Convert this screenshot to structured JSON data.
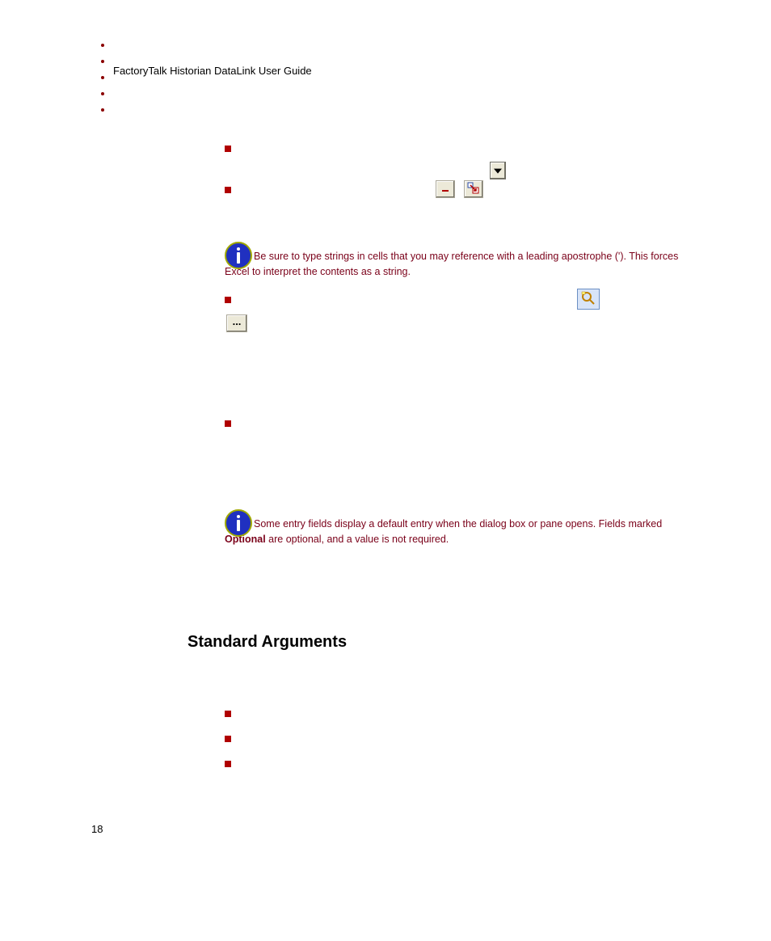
{
  "doc": {
    "title": "FactoryTalk Historian DataLink User Guide",
    "page_number": "18"
  },
  "bullets": {
    "b1_text": "",
    "b2_text": "",
    "b3_text": "",
    "b4_text": ""
  },
  "notes": {
    "note1": "Be sure to type strings in cells that you may reference with a leading apostrophe ('). This forces Excel to interpret the contents as a string.",
    "note2_pre": "Some entry fields display a default entry when the dialog box or pane opens. Fields marked ",
    "note2_bold": "Optional",
    "note2_post": " are optional, and a value is not required."
  },
  "section": {
    "heading": "Standard Arguments"
  },
  "std_bullets": {
    "s1": "",
    "s2": "",
    "s3": ""
  },
  "ellipsis": "..."
}
